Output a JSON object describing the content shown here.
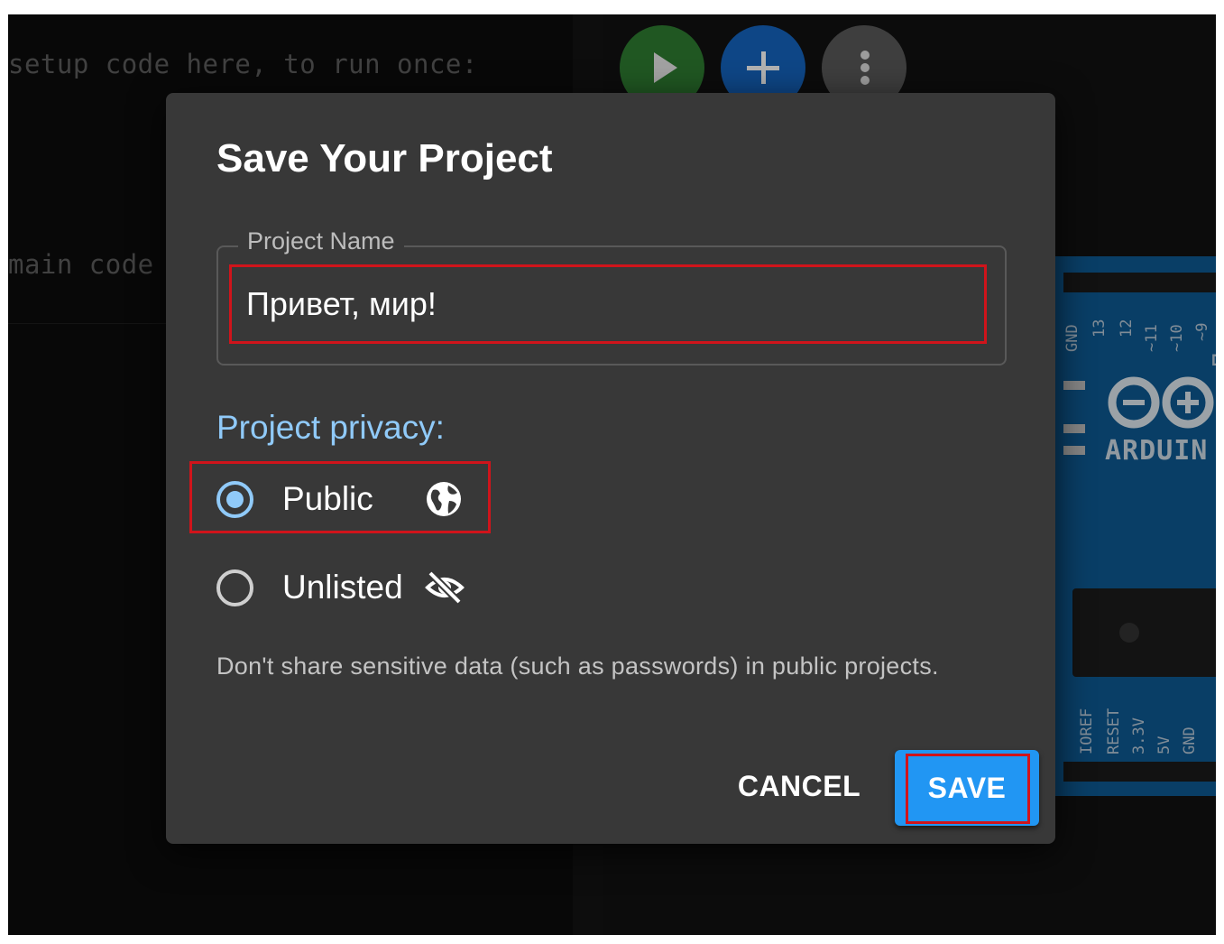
{
  "editor": {
    "lines": [
      "setup code here, to run once:",
      "main code"
    ]
  },
  "toolbar": {
    "run_icon": "play-icon",
    "add_icon": "plus-icon",
    "more_icon": "more-vertical-icon"
  },
  "board": {
    "logo_text": "ARDUIN",
    "top_pins": [
      "GND",
      "13",
      "12",
      "~11",
      "~10",
      "~9",
      "D"
    ],
    "bottom_pins": [
      "IOREF",
      "RESET",
      "3.3V",
      "5V",
      "GND"
    ]
  },
  "dialog": {
    "title": "Save Your Project",
    "project_name_label": "Project Name",
    "project_name_value": "Привет, мир!",
    "privacy_label": "Project privacy:",
    "options": [
      {
        "label": "Public",
        "icon": "globe-icon",
        "checked": true
      },
      {
        "label": "Unlisted",
        "icon": "eye-off-icon",
        "checked": false
      }
    ],
    "warning": "Don't share sensitive data (such as passwords) in public projects.",
    "cancel_label": "CANCEL",
    "save_label": "SAVE"
  },
  "colors": {
    "accent": "#2196f3",
    "privacy_label": "#90caf9",
    "highlight": "#d0141b",
    "dialog_bg": "#383838"
  }
}
